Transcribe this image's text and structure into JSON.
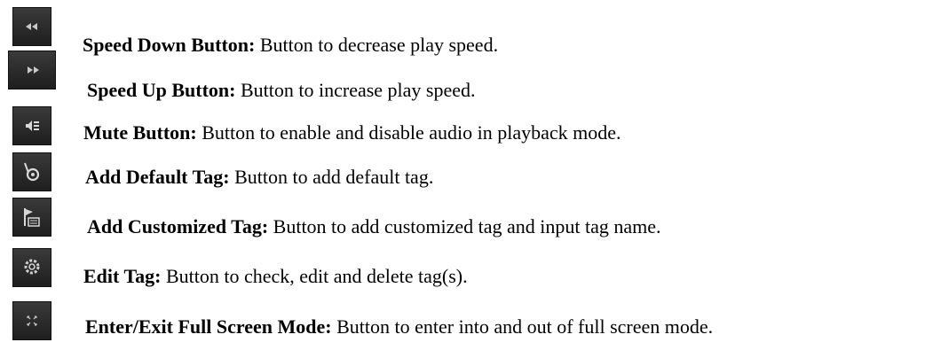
{
  "items": [
    {
      "icon": "speed-down-icon",
      "title": "Speed Down Button:",
      "text": " Button to decrease play speed."
    },
    {
      "icon": "speed-up-icon",
      "title": "Speed Up Button:",
      "text": " Button to increase play speed."
    },
    {
      "icon": "mute-icon",
      "title": "Mute Button:",
      "text": " Button to enable and disable audio in playback mode."
    },
    {
      "icon": "add-default-tag-icon",
      "title": "Add Default Tag:",
      "text": " Button to add default tag."
    },
    {
      "icon": "add-customized-tag-icon",
      "title": "Add Customized Tag:",
      "text": " Button to add customized tag and input tag name."
    },
    {
      "icon": "edit-tag-icon",
      "title": "Edit Tag:",
      "text": " Button to check, edit and delete tag(s)."
    },
    {
      "icon": "fullscreen-icon",
      "title": "Enter/Exit Full Screen Mode:",
      "text": " Button to enter into and out of full screen mode."
    }
  ]
}
